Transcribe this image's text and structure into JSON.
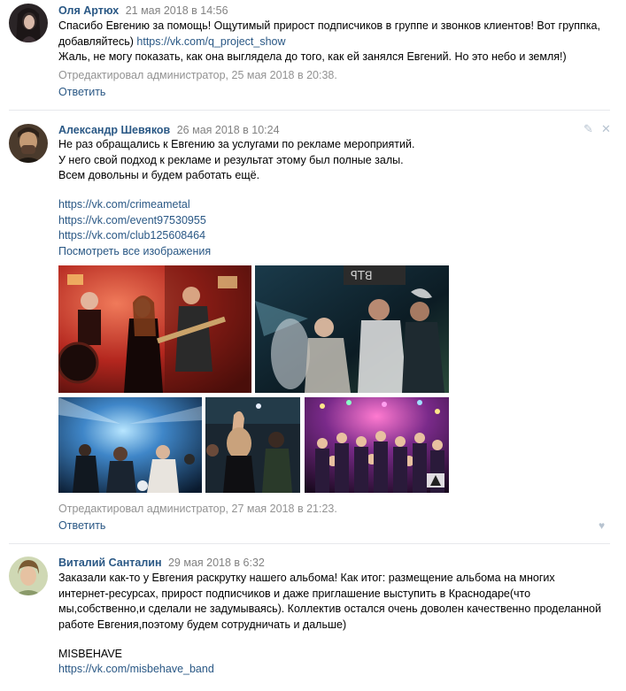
{
  "comments": [
    {
      "author": "Оля Артюх",
      "date": "21 мая 2018 в 14:56",
      "lines": [
        "Спасибо Евгению за помощь! Ощутимый прирост подписчиков в группе и звонков клиентов! Вот группка, добавляйтесь) ",
        "https://vk.com/q_project_show",
        "Жаль, не могу показать, как она выглядела до того, как ей занялся Евгений. Но это небо и земля!)"
      ],
      "edited": "Отредактировал администратор, 25 мая 2018 в 20:38.",
      "reply": "Ответить"
    },
    {
      "author": "Александр Шевяков",
      "date": "26 мая 2018 в 10:24",
      "lines": [
        "Не раз обращались к Евгению за услугами по рекламе мероприятий.",
        "У него свой подход к рекламе и результат этому был полные залы.",
        "Всем довольны и будем работать ещё."
      ],
      "links": [
        "https://vk.com/crimeametal",
        "https://vk.com/event97530955",
        "https://vk.com/club125608464"
      ],
      "view_all": "Посмотреть все изображения",
      "edited": "Отредактировал администратор, 27 мая 2018 в 21:23.",
      "reply": "Ответить",
      "icons": {
        "edit": "pencil-icon",
        "delete": "close-icon",
        "like": "heart-icon"
      }
    },
    {
      "author": "Виталий Санталин",
      "date": "29 мая 2018 в 6:32",
      "text": "Заказали как-то у Евгения раскрутку нашего альбома! Как итог: размещение альбома на многих интернет-ресурсах, прирост подписчиков и даже приглашение выступить в Краснодаре(что мы,собственно,и сделали не задумываясь). Коллектив остался очень доволен качественно проделанной работе Евгения,поэтому будем сотрудничать и дальше)",
      "band": "MISBEHAVE",
      "link": "https://vk.com/misbehave_band"
    }
  ],
  "colors": {
    "link": "#2a5885",
    "meta": "#939393",
    "separator": "#e7e8ec"
  }
}
